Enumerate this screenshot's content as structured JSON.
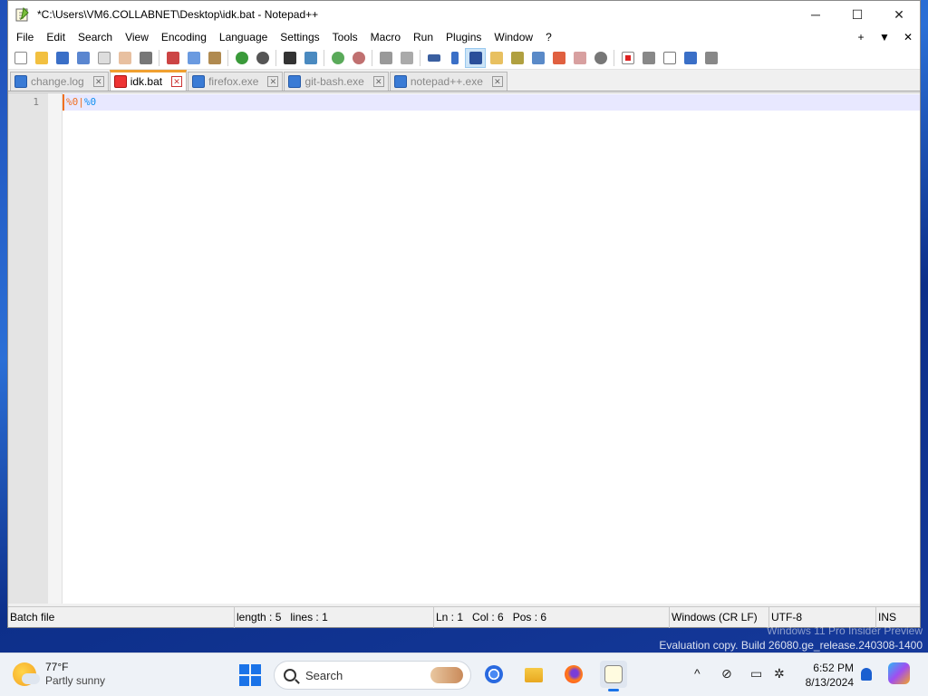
{
  "window": {
    "title": "*C:\\Users\\VM6.COLLABNET\\Desktop\\idk.bat - Notepad++",
    "controls": {
      "minimize": "─",
      "maximize": "☐",
      "close": "✕"
    }
  },
  "menu": {
    "items": [
      "File",
      "Edit",
      "Search",
      "View",
      "Encoding",
      "Language",
      "Settings",
      "Tools",
      "Macro",
      "Run",
      "Plugins",
      "Window",
      "?"
    ],
    "right": [
      "+",
      "▼",
      "✕"
    ]
  },
  "tabs": [
    {
      "label": "change.log",
      "active": false
    },
    {
      "label": "idk.bat",
      "active": true
    },
    {
      "label": "firefox.exe",
      "active": false
    },
    {
      "label": "git-bash.exe",
      "active": false
    },
    {
      "label": "notepad++.exe",
      "active": false
    }
  ],
  "editor": {
    "line_number": "1",
    "code_part1": "%0|",
    "code_part2": "%0"
  },
  "status": {
    "file_type": "Batch file",
    "length": "length : 5",
    "lines": "lines : 1",
    "ln": "Ln : 1",
    "col": "Col : 6",
    "pos": "Pos : 6",
    "eol": "Windows (CR LF)",
    "encoding": "UTF-8",
    "mode": "INS"
  },
  "watermark": {
    "line1": "Windows 11 Pro Insider Preview",
    "line2": "Evaluation copy. Build 26080.ge_release.240308-1400"
  },
  "taskbar": {
    "weather_temp": "77°F",
    "weather_desc": "Partly sunny",
    "search_label": "Search",
    "time": "6:52 PM",
    "date": "8/13/2024"
  },
  "colors": {
    "accent": "#1a73e8",
    "active_tab_border": "#f0a030",
    "line_highlight": "#e8e8ff",
    "code_operator": "#f07020",
    "code_number": "#1090f0"
  }
}
